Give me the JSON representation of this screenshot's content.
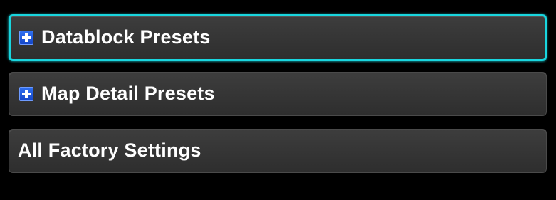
{
  "menu": {
    "items": [
      {
        "label": "Datablock Presets",
        "icon": "expand-plus-icon",
        "selected": true
      },
      {
        "label": "Map Detail Presets",
        "icon": "expand-plus-icon",
        "selected": false
      },
      {
        "label": "All Factory Settings",
        "icon": null,
        "selected": false
      }
    ]
  },
  "colors": {
    "background": "#000000",
    "button": "#353535",
    "selection_border": "#19d6df",
    "icon_blue": "#1f5ae0",
    "text": "#ffffff"
  }
}
